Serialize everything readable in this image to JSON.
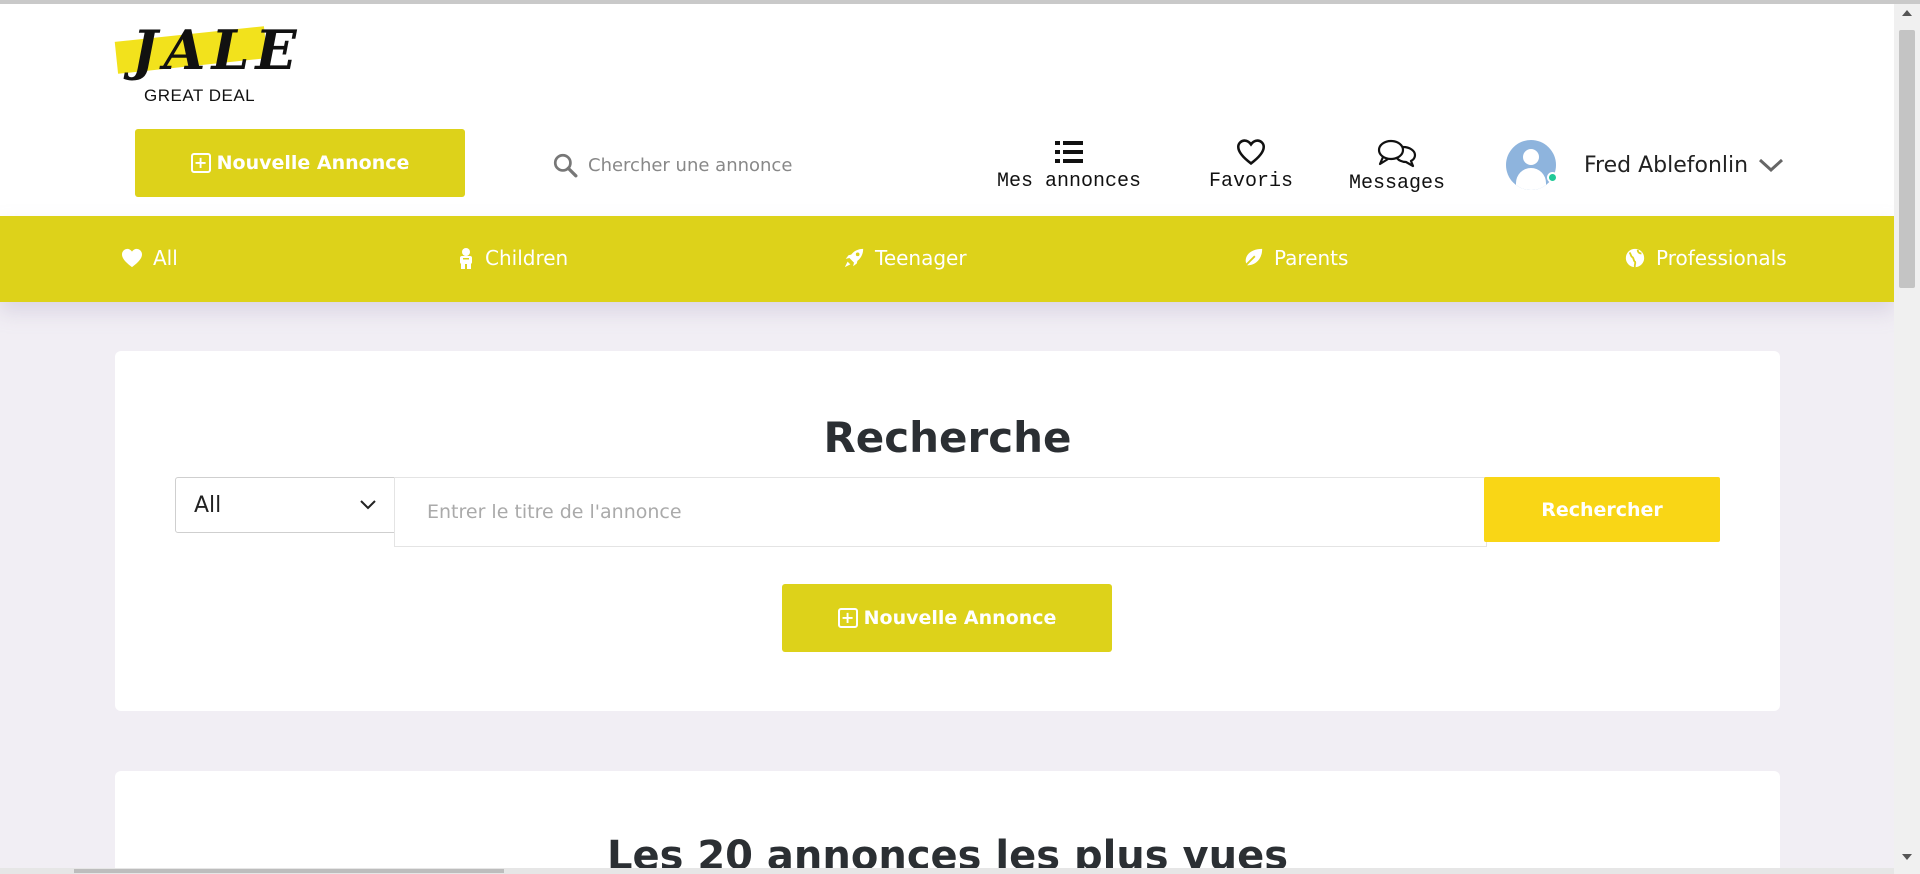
{
  "logo": {
    "text": "JALE",
    "subtitle": "GREAT DEAL"
  },
  "header": {
    "new_ad_label": "Nouvelle Annonce",
    "search_placeholder": "Chercher une annonce",
    "nav": {
      "my_ads": "Mes annonces",
      "favorites": "Favoris",
      "messages": "Messages"
    },
    "user": {
      "name": "Fred Ablefonlin",
      "status_color": "#20c997"
    }
  },
  "categories": [
    {
      "label": "All",
      "icon": "heart-icon"
    },
    {
      "label": "Children",
      "icon": "child-icon"
    },
    {
      "label": "Teenager",
      "icon": "rocket-icon"
    },
    {
      "label": "Parents",
      "icon": "leaf-icon"
    },
    {
      "label": "Professionals",
      "icon": "globe-icon"
    }
  ],
  "search_card": {
    "title": "Recherche",
    "category_select": "All",
    "input_placeholder": "Entrer le titre de l'annonce",
    "search_button": "Rechercher",
    "new_ad_label": "Nouvelle Annonce"
  },
  "top_card": {
    "title": "Les 20 annonces les plus vues"
  },
  "colors": {
    "accent": "#ddd21a",
    "search_button": "#f9d616",
    "background": "#f1eef4"
  }
}
